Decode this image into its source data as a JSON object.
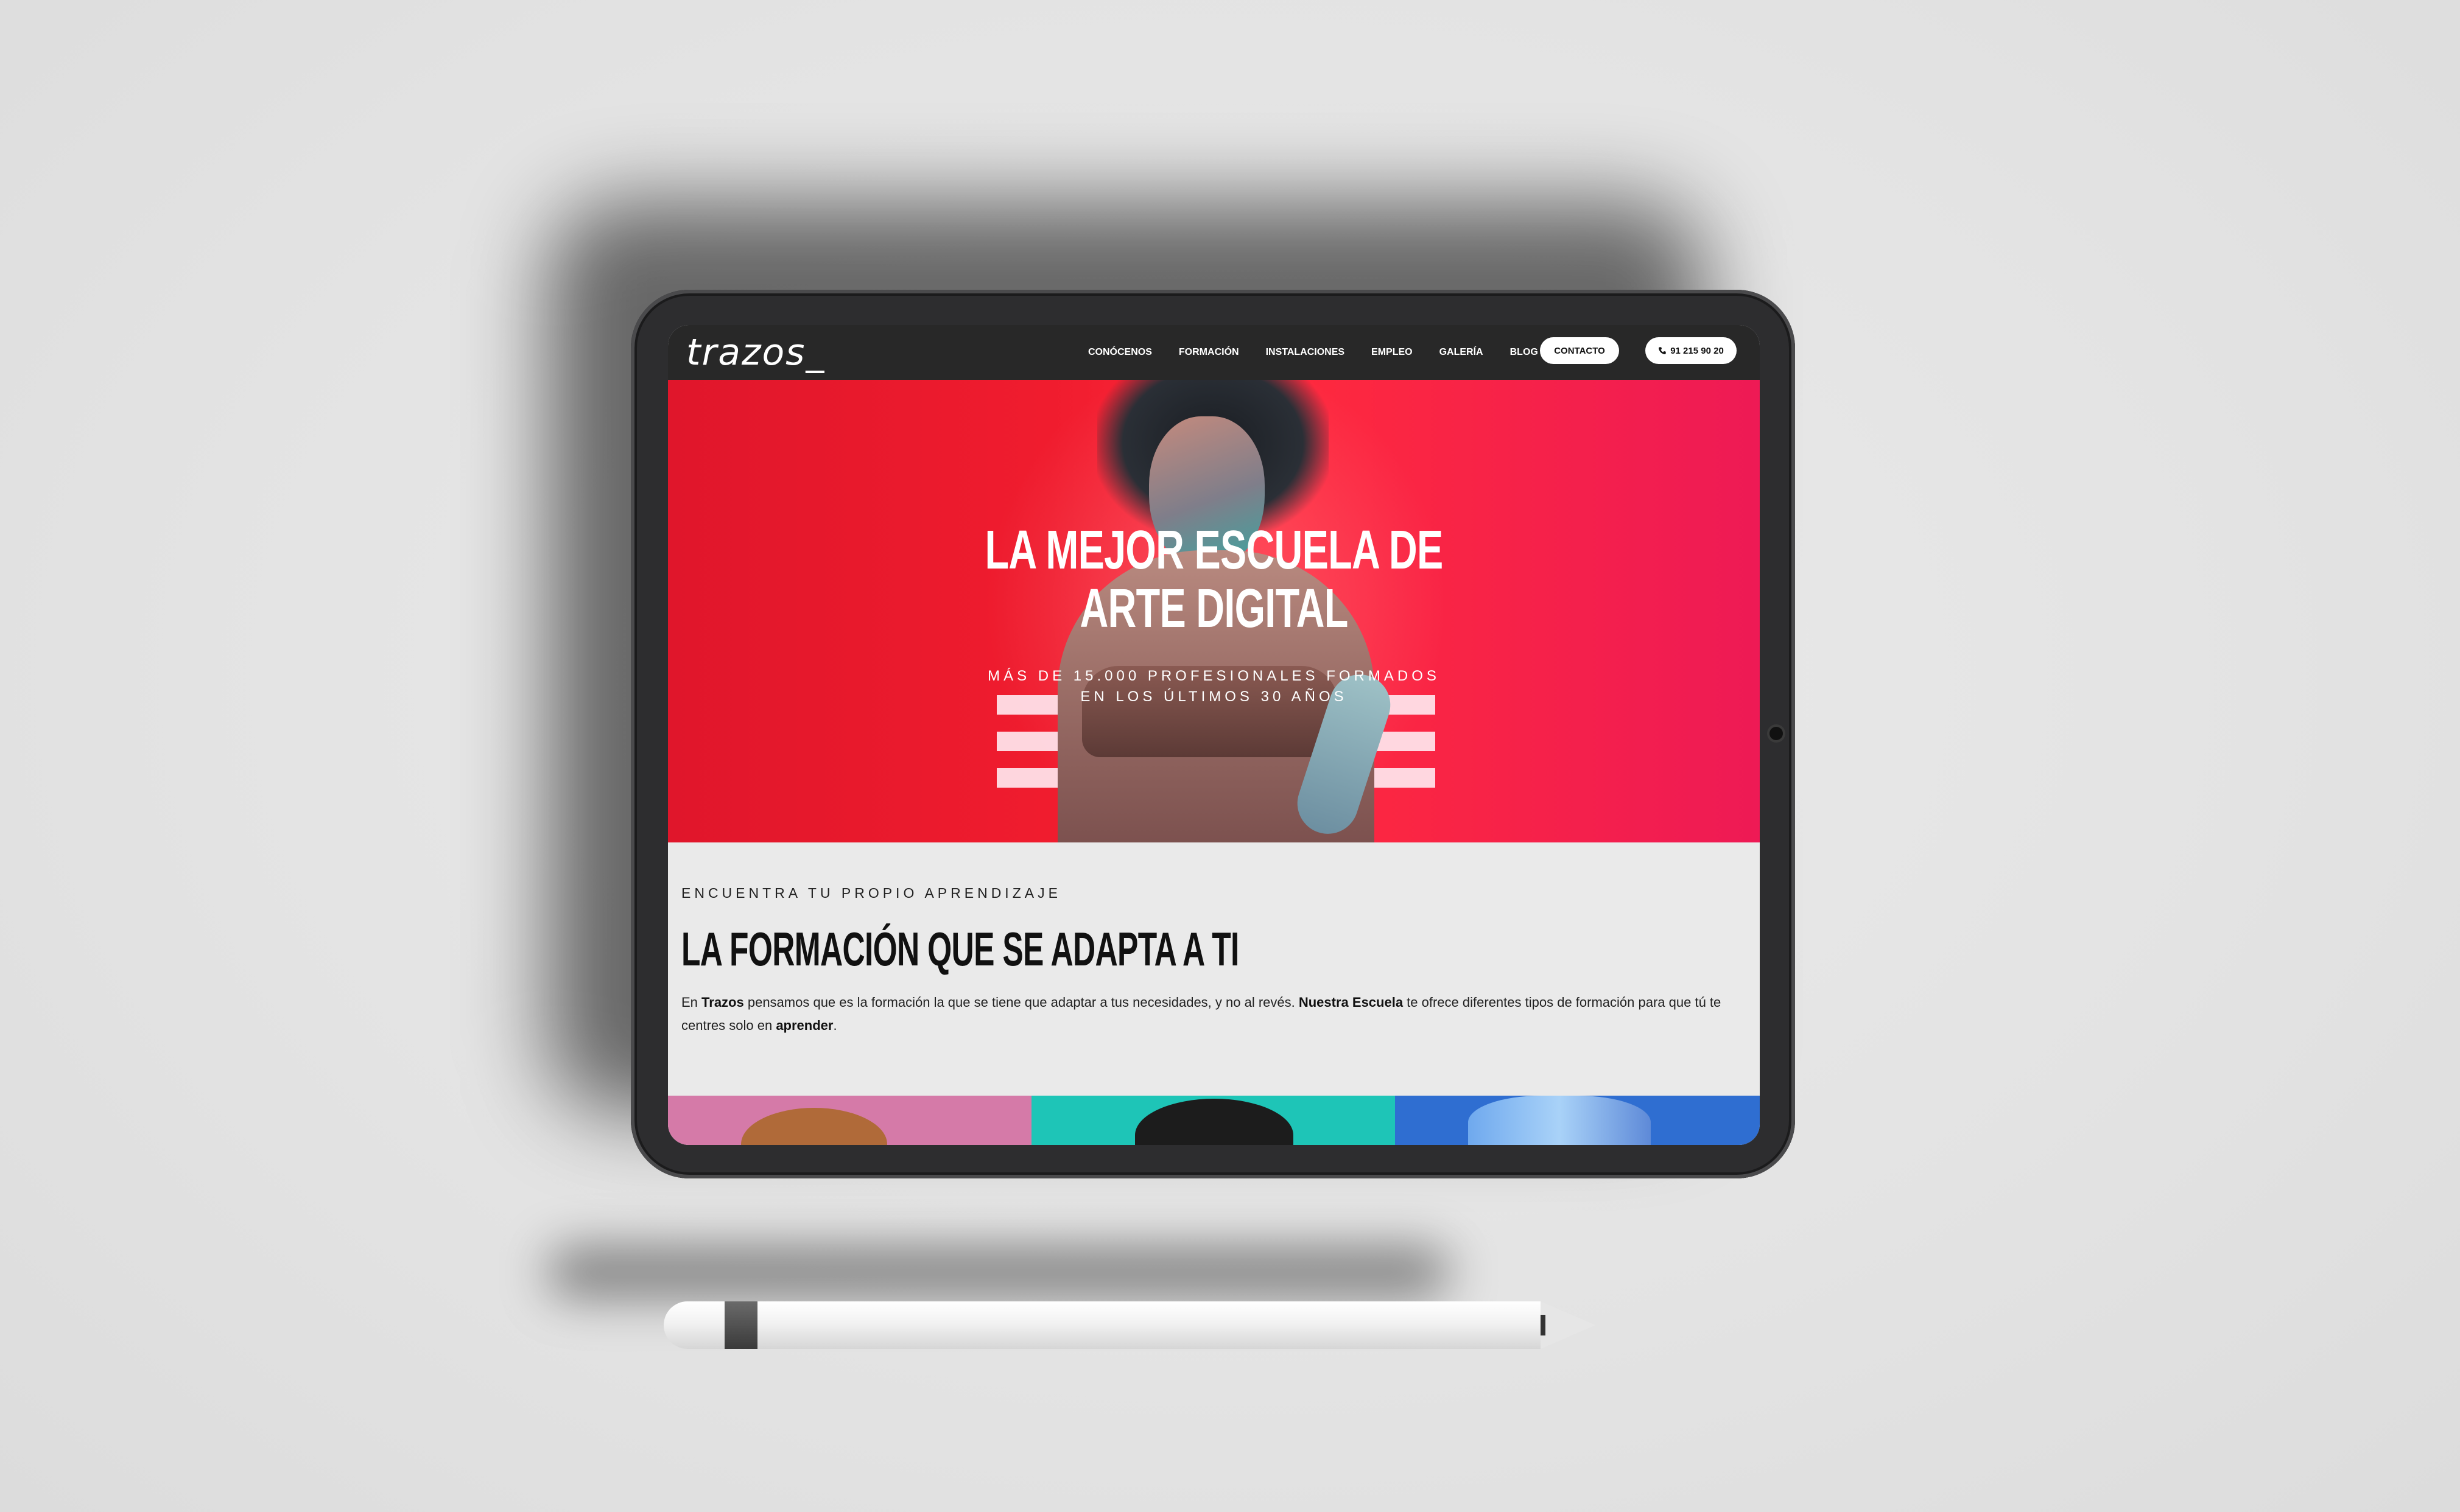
{
  "site": {
    "logo": "trazos_",
    "nav": {
      "items": [
        "CONÓCENOS",
        "FORMACIÓN",
        "INSTALACIONES",
        "EMPLEO",
        "GALERÍA",
        "BLOG"
      ],
      "contact_label": "CONTACTO",
      "phone_label": "91 215 90 20",
      "phone_icon": "phone-icon"
    },
    "hero": {
      "title_line1": "LA MEJOR ESCUELA DE",
      "title_line2": "ARTE DIGITAL",
      "subtitle_line1": "MÁS DE 15.000 PROFESIONALES FORMADOS",
      "subtitle_line2": "EN LOS ÚLTIMOS 30 AÑOS"
    },
    "section": {
      "kicker": "ENCUENTRA TU PROPIO APRENDIZAJE",
      "title": "LA FORMACIÓN QUE SE ADAPTA A TI",
      "body": {
        "p1": "En ",
        "b1": "Trazos",
        "p2": " pensamos que es la formación la que se tiene que adaptar a tus necesidades, y no al revés. ",
        "b2": "Nuestra Escuela",
        "p3": " te ofrece diferentes tipos de formación para que tú te centres solo en ",
        "b3": "aprender",
        "p4": "."
      }
    }
  },
  "colors": {
    "nav_bg": "#282828",
    "hero_red": "#f01c2e",
    "card_pink": "#d57aa8",
    "card_teal": "#1ec5b7",
    "card_blue": "#2f6ed1"
  }
}
